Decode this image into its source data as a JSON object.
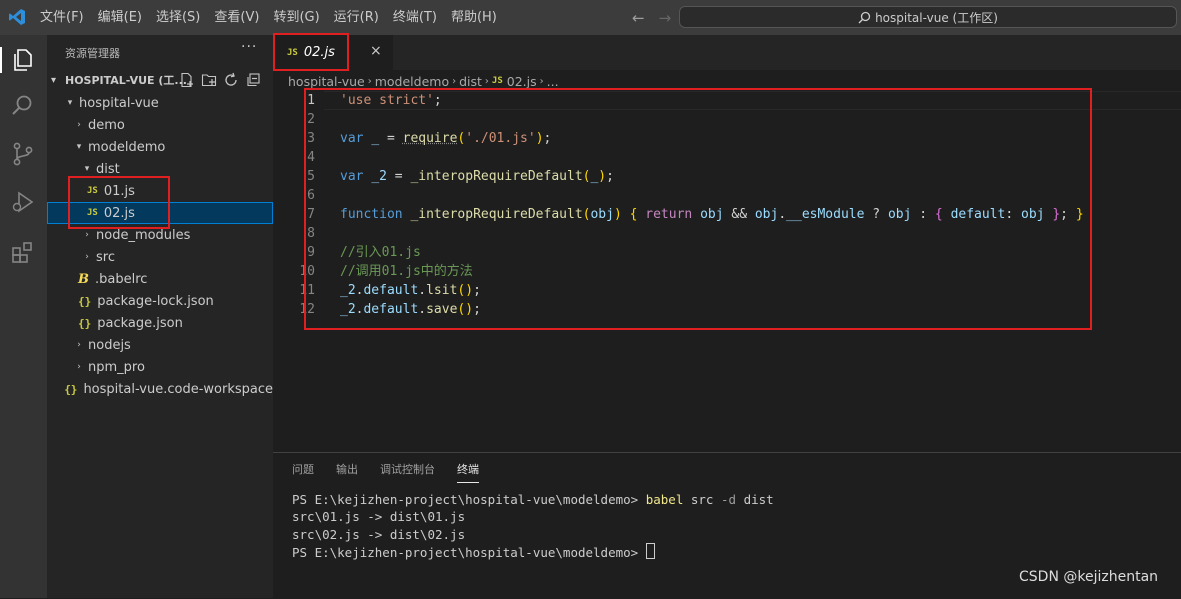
{
  "titlebar": {
    "menu": [
      "文件(F)",
      "编辑(E)",
      "选择(S)",
      "查看(V)",
      "转到(G)",
      "运行(R)",
      "终端(T)",
      "帮助(H)"
    ],
    "search_text": "hospital-vue (工作区)"
  },
  "sidebar": {
    "header": "资源管理器",
    "more": "···",
    "workspace_title": "HOSPITAL-VUE (工...",
    "tree": [
      {
        "label": "hospital-vue",
        "icon": "chevron-down"
      },
      {
        "label": "demo",
        "icon": "chevron-right"
      },
      {
        "label": "modeldemo",
        "icon": "chevron-down"
      },
      {
        "label": "dist",
        "icon": "chevron-down"
      },
      {
        "label": "01.js",
        "icon": "js"
      },
      {
        "label": "02.js",
        "icon": "js"
      },
      {
        "label": "node_modules",
        "icon": "chevron-right"
      },
      {
        "label": "src",
        "icon": "chevron-right"
      },
      {
        "label": ".babelrc",
        "icon": "babel"
      },
      {
        "label": "package-lock.json",
        "icon": "json"
      },
      {
        "label": "package.json",
        "icon": "json"
      },
      {
        "label": "nodejs",
        "icon": "chevron-right"
      },
      {
        "label": "npm_pro",
        "icon": "chevron-right"
      },
      {
        "label": "hospital-vue.code-workspace",
        "icon": "json"
      }
    ],
    "js_badge": "JS",
    "json_badge": "{}",
    "babel_badge": "B"
  },
  "editor": {
    "tab_label": "02.js",
    "tab_close": "×",
    "breadcrumb": [
      "hospital-vue",
      "modeldemo",
      "dist",
      "02.js",
      "..."
    ],
    "line_numbers": [
      "1",
      "2",
      "3",
      "4",
      "5",
      "6",
      "7",
      "8",
      "9",
      "10",
      "11",
      "12"
    ],
    "code": {
      "l1_str": "'use strict'",
      "l3_var": "var",
      "l3_name": "_",
      "l3_req": "require",
      "l3_arg": "'./01.js'",
      "l5_var": "var",
      "l5_name": "_2",
      "l5_fn": "_interopRequireDefault",
      "l7_function": "function",
      "l7_fn": "_interopRequireDefault",
      "l7_param": "obj",
      "l7_return": "return",
      "l7_esm": "__esModule",
      "l7_default": "default",
      "l9": "//引入01.js",
      "l10": "//调用01.js中的方法",
      "l11_name": "_2",
      "l11_default": "default",
      "l11_method": "lsit",
      "l12_name": "_2",
      "l12_default": "default",
      "l12_method": "save"
    }
  },
  "panel": {
    "tabs": [
      "问题",
      "输出",
      "调试控制台",
      "终端"
    ],
    "terminal": {
      "prompt1": "PS E:\\kejizhen-project\\hospital-vue\\modeldemo> ",
      "cmd": "babel",
      "cmd_args": " src ",
      "flag": "-d",
      "cmd_rest": " dist",
      "out1": "src\\01.js -> dist\\01.js",
      "out2": "src\\02.js -> dist\\02.js",
      "prompt2": "PS E:\\kejizhen-project\\hospital-vue\\modeldemo> "
    }
  },
  "watermark": "CSDN @kejizhentan",
  "colors": {
    "accent": "#007acc",
    "highlight_box": "#e02020",
    "js_badge": "#cbcb41"
  }
}
